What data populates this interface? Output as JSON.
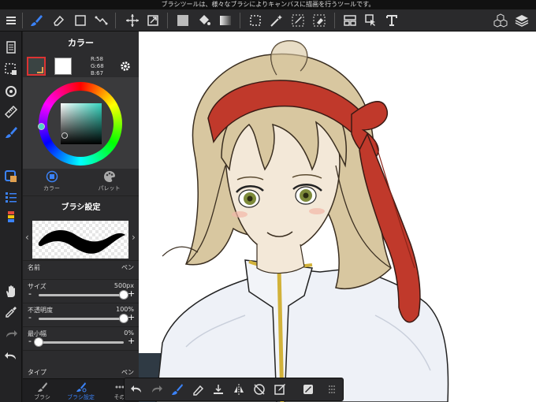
{
  "tip": "ブラシツールは、様々なブラシによりキャンバスに描画を行うツールです。",
  "toolbar": {
    "icons": [
      "menu-icon",
      "brush-icon",
      "eraser-icon",
      "rectangle-icon",
      "bucket-mode-icon",
      "move-icon",
      "transform-icon",
      "fill-color-icon",
      "bucket-fill-icon",
      "gradient-icon",
      "select-rect-icon",
      "magic-wand-icon",
      "select-pen-icon",
      "select-eraser-icon",
      "snap-icon",
      "lasso-icon",
      "text-icon",
      "3d-material-icon",
      "layers-icon"
    ]
  },
  "colors": {
    "accent": "#3b82f6",
    "panel": "#3a3a3c",
    "dark": "#2c2c2e",
    "hair": "#d8c7a0",
    "ribbon": "#c0392b"
  },
  "color_panel": {
    "title": "カラー",
    "r": "R:58",
    "g": "G:68",
    "b": "B:67",
    "tab_color": "カラー",
    "tab_palette": "パレット"
  },
  "brush_panel": {
    "title": "ブラシ設定",
    "name_label": "名前",
    "name_value": "ペン",
    "size_label": "サイズ",
    "size_value": "500px",
    "size_level": 1.0,
    "opacity_label": "不透明度",
    "opacity_value": "100%",
    "opacity_level": 1.0,
    "minwidth_label": "最小幅",
    "minwidth_value": "0%",
    "minwidth_level": 0.0,
    "type_label": "タイプ",
    "type_value": "ペン"
  },
  "bottom_tabs": {
    "brush": "ブラシ",
    "brush_settings": "ブラシ設定",
    "other": "その"
  }
}
